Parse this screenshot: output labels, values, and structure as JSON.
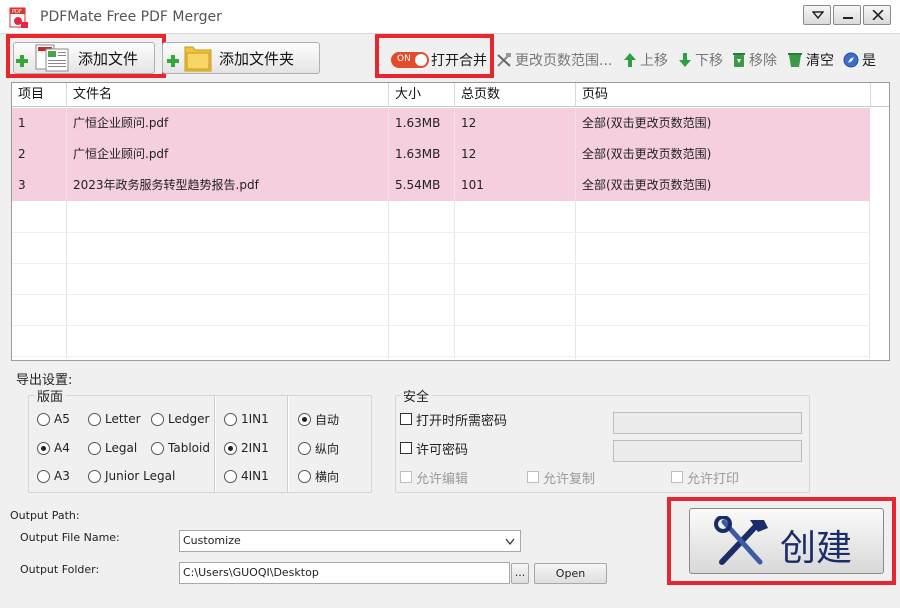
{
  "window": {
    "title": "PDFMate Free PDF Merger"
  },
  "toolbar": {
    "add_file": "添加文件",
    "add_folder": "添加文件夹",
    "toggle_text": "ON",
    "open_merge": "打开合并",
    "change_range": "更改页数范围...",
    "move_up": "上移",
    "move_down": "下移",
    "remove": "移除",
    "clear": "清空",
    "yes": "是"
  },
  "table": {
    "headers": [
      "项目",
      "文件名",
      "大小",
      "总页数",
      "页码"
    ],
    "rows": [
      {
        "item": "1",
        "name": "广恒企业顾问.pdf",
        "size": "1.63MB",
        "pages": "12",
        "range": "全部(双击更改页数范围)"
      },
      {
        "item": "2",
        "name": "广恒企业顾问.pdf",
        "size": "1.63MB",
        "pages": "12",
        "range": "全部(双击更改页数范围)"
      },
      {
        "item": "3",
        "name": "2023年政务服务转型趋势报告.pdf",
        "size": "5.54MB",
        "pages": "101",
        "range": "全部(双击更改页数范围)"
      }
    ],
    "row_color": "#f5cfdf"
  },
  "settings": {
    "title": "导出设置:",
    "layout_legend": "版面",
    "paper": [
      [
        "A5",
        "Letter",
        "Ledger"
      ],
      [
        "A4",
        "Legal",
        "Tabloid"
      ],
      [
        "A3",
        "Junior Legal",
        ""
      ]
    ],
    "paper_selected": "A4",
    "nup": [
      "1IN1",
      "2IN1",
      "4IN1"
    ],
    "nup_selected": "2IN1",
    "orientation": [
      "自动",
      "纵向",
      "横向"
    ],
    "orientation_selected": "自动",
    "security_legend": "安全",
    "open_password": "打开时所需密码",
    "permission_password": "许可密码",
    "allow_edit": "允许编辑",
    "allow_copy": "允许复制",
    "allow_print": "允许打印"
  },
  "output": {
    "path_label": "Output Path:",
    "file_name_label": "Output File Name:",
    "file_name_value": "Customize",
    "folder_label": "Output Folder:",
    "folder_value": "C:\\Users\\GUOQI\\Desktop",
    "browse_label": "...",
    "open_label": "Open"
  },
  "create": {
    "label": "创建"
  },
  "colors": {
    "highlight_box": "#e8262d",
    "toggle": "#e24c2c",
    "up_arrow": "#2ea043",
    "create_text": "#1a2d66"
  }
}
